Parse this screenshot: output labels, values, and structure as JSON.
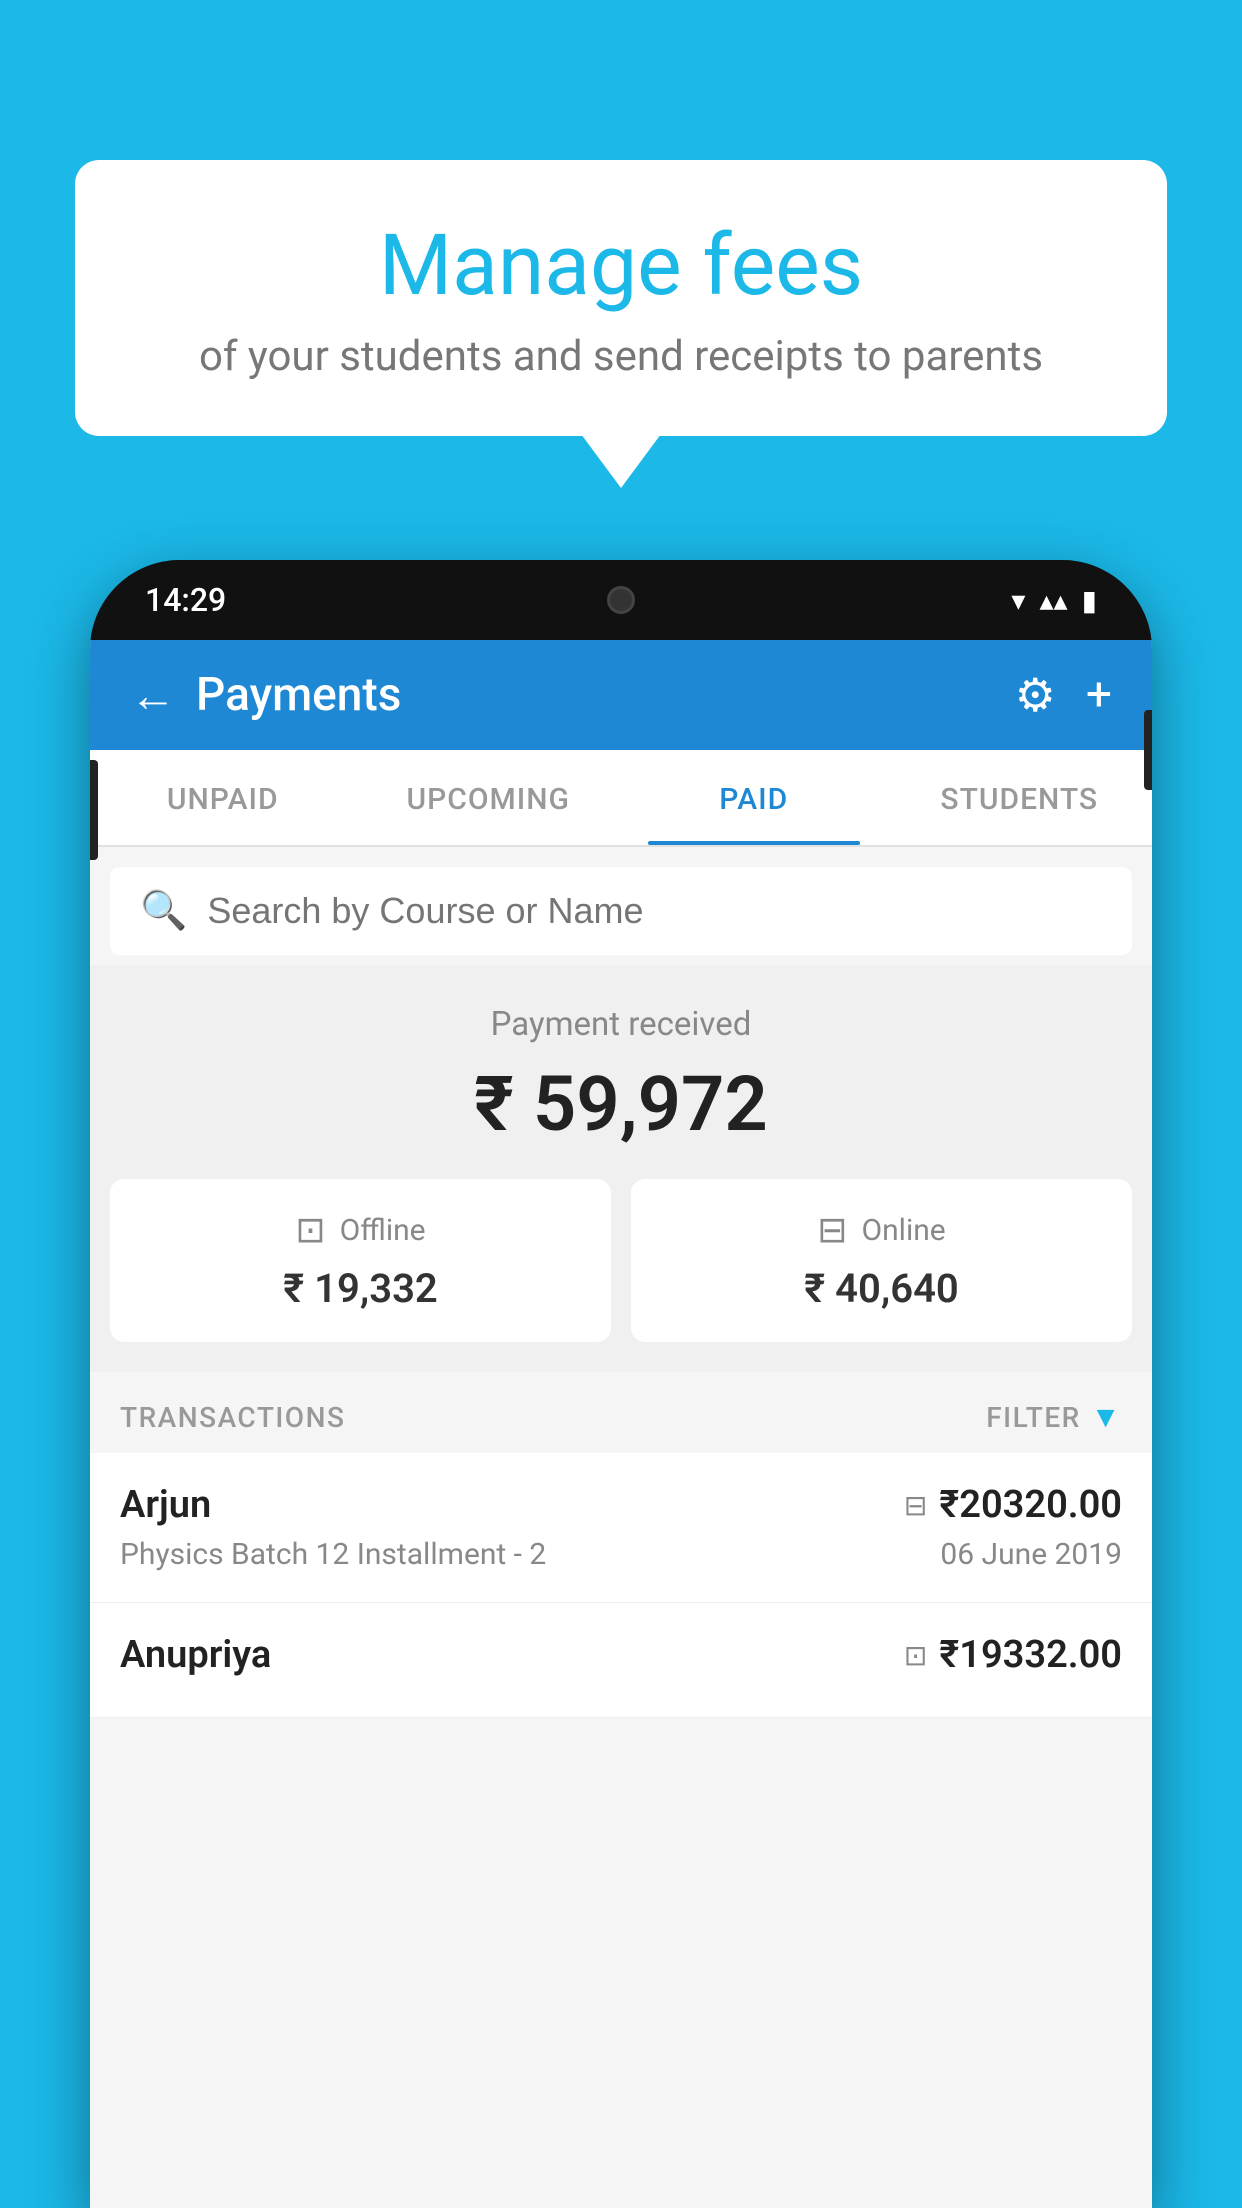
{
  "background": {
    "color": "#1BB8E8"
  },
  "speech_bubble": {
    "title": "Manage fees",
    "subtitle": "of your students and send receipts to parents"
  },
  "phone": {
    "time": "14:29",
    "status_icons": [
      "▼",
      "▲",
      "▮"
    ]
  },
  "app": {
    "header": {
      "back_label": "←",
      "title": "Payments",
      "gear_icon": "⚙",
      "plus_icon": "+"
    },
    "tabs": [
      {
        "label": "UNPAID",
        "active": false
      },
      {
        "label": "UPCOMING",
        "active": false
      },
      {
        "label": "PAID",
        "active": true
      },
      {
        "label": "STUDENTS",
        "active": false
      }
    ],
    "search": {
      "placeholder": "Search by Course or Name"
    },
    "payment_summary": {
      "label": "Payment received",
      "amount": "₹ 59,972",
      "offline": {
        "label": "Offline",
        "amount": "₹ 19,332"
      },
      "online": {
        "label": "Online",
        "amount": "₹ 40,640"
      }
    },
    "transactions": {
      "section_label": "TRANSACTIONS",
      "filter_label": "FILTER",
      "rows": [
        {
          "name": "Arjun",
          "course": "Physics Batch 12 Installment - 2",
          "amount": "₹20320.00",
          "date": "06 June 2019",
          "payment_type": "card"
        },
        {
          "name": "Anupriya",
          "course": "",
          "amount": "₹19332.00",
          "date": "",
          "payment_type": "offline"
        }
      ]
    }
  }
}
